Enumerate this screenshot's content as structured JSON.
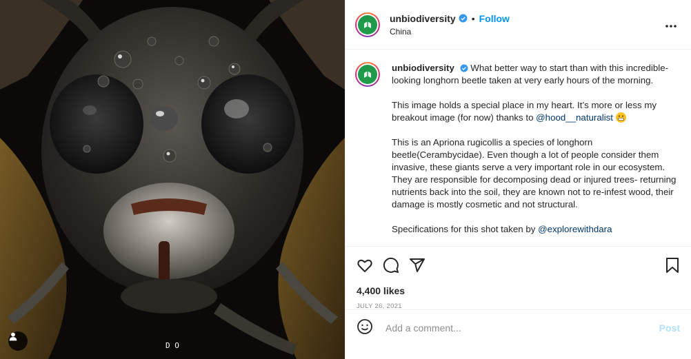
{
  "post": {
    "username": "unbiodiversity",
    "location": "China",
    "follow_label": "Follow",
    "separator": "•",
    "caption": {
      "username": "unbiodiversity",
      "p1": "What better way to start than with this incredible-looking longhorn beetle taken at very early hours of the morning.",
      "p2_text": "This image holds a special place in my heart. It’s more or less my breakout image (for now) thanks to ",
      "p2_mention": "@hood__naturalist",
      "p3": "This is an Apriona rugicollis a species of longhorn beetle(Cerambycidae). Even though a lot of people consider them invasive, these giants serve a very important role in our ecosystem. They are responsible for decomposing dead or injured trees- returning nutrients back into the soil, they are known not to re-infest wood, their damage is mostly cosmetic and not structural.",
      "p4_text": "Specifications for this shot taken by ",
      "p4_mention": "@explorewithdara"
    },
    "likes": "4,400 likes",
    "date": "JULY 26, 2021"
  },
  "comment": {
    "placeholder": "Add a comment...",
    "post_label": "Post"
  },
  "watermark": "D O",
  "colors": {
    "accent": "#0095f6",
    "brand_green": "#1f9a4a",
    "post_disabled": "#b2dffc"
  },
  "icons": [
    "heart-icon",
    "comment-icon",
    "share-icon",
    "bookmark-icon",
    "more-icon",
    "emoji-icon",
    "verified-icon",
    "user-tag-icon"
  ]
}
